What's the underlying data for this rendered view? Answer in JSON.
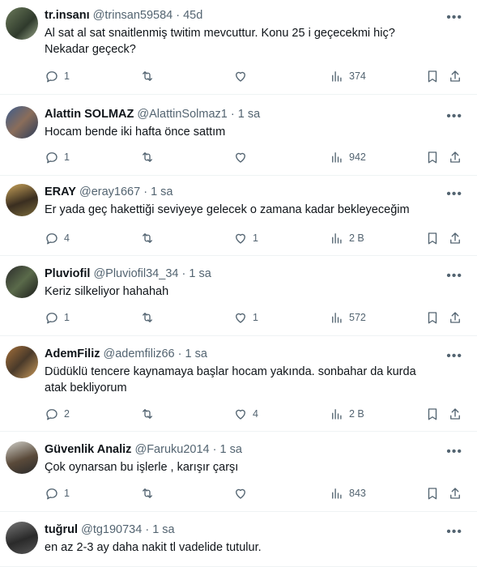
{
  "tweets": [
    {
      "name": "tr.insanı",
      "handle": "@trinsan59584",
      "sep": "·",
      "time": "45d",
      "text": "Al sat al sat snaitlenmiş twitim mevcuttur. Konu 25 i geçecekmi hiç?\nNekadar geçeck?",
      "replies": "1",
      "retweets": "",
      "likes": "",
      "views": "374"
    },
    {
      "name": "Alattin SOLMAZ",
      "handle": "@AlattinSolmaz1",
      "sep": "·",
      "time": "1 sa",
      "text": "Hocam bende iki hafta önce sattım",
      "replies": "1",
      "retweets": "",
      "likes": "",
      "views": "942"
    },
    {
      "name": "ERAY",
      "handle": "@eray1667",
      "sep": "·",
      "time": "1 sa",
      "text": "Er yada geç hakettiği seviyeye gelecek o zamana kadar bekleyeceğim",
      "replies": "4",
      "retweets": "",
      "likes": "1",
      "views": "2 B"
    },
    {
      "name": "Pluviofil",
      "handle": "@Pluviofil34_34",
      "sep": "·",
      "time": "1 sa",
      "text": "Keriz silkeliyor hahahah",
      "replies": "1",
      "retweets": "",
      "likes": "1",
      "views": "572"
    },
    {
      "name": "AdemFiliz",
      "handle": "@ademfiliz66",
      "sep": "·",
      "time": "1 sa",
      "text": "Düdüklü tencere kaynamaya başlar hocam yakında. sonbahar da kurda\natak bekliyorum",
      "replies": "2",
      "retweets": "",
      "likes": "4",
      "views": "2 B"
    },
    {
      "name": "Güvenlik Analiz",
      "handle": "@Faruku2014",
      "sep": "·",
      "time": "1 sa",
      "text": "Çok oynarsan bu işlerle , karışır çarşı",
      "replies": "1",
      "retweets": "",
      "likes": "",
      "views": "843"
    },
    {
      "name": "tuğrul",
      "handle": "@tg190734",
      "sep": "·",
      "time": "1 sa",
      "text": "en az 2-3 ay daha nakit tl vadelide tutulur.",
      "replies": "",
      "retweets": "",
      "likes": "",
      "views": ""
    }
  ],
  "icons": {
    "more": "more-horizontal-icon",
    "reply": "reply-icon",
    "retweet": "retweet-icon",
    "like": "heart-icon",
    "views": "views-icon",
    "bookmark": "bookmark-icon",
    "share": "share-icon"
  },
  "colors": {
    "text": "#0f1419",
    "secondary": "#536471",
    "divider": "#eff3f4"
  }
}
